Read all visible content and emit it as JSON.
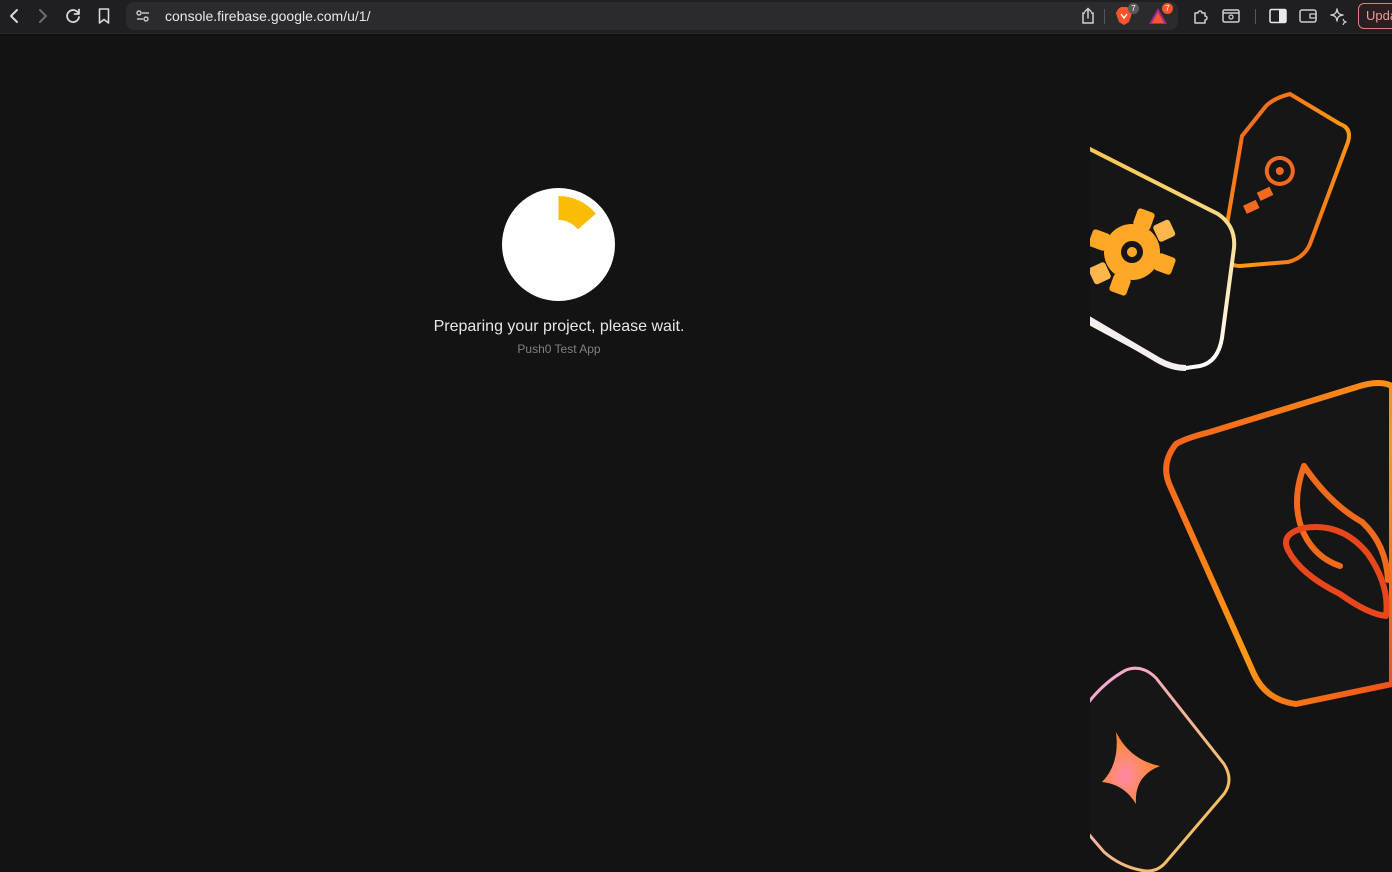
{
  "browser": {
    "url": "console.firebase.google.com/u/1/",
    "brave_shields_count": "7",
    "rewards_count": "7",
    "update_label": "Update",
    "accent": "#fb542b"
  },
  "main": {
    "status_title": "Preparing your project, please wait.",
    "project_name": "Push0 Test App",
    "spinner_color": "#fbbc04"
  },
  "decoration": {
    "tiles": [
      "gear-tile",
      "analytics-tile",
      "flame-tile",
      "sparkle-tile"
    ]
  }
}
